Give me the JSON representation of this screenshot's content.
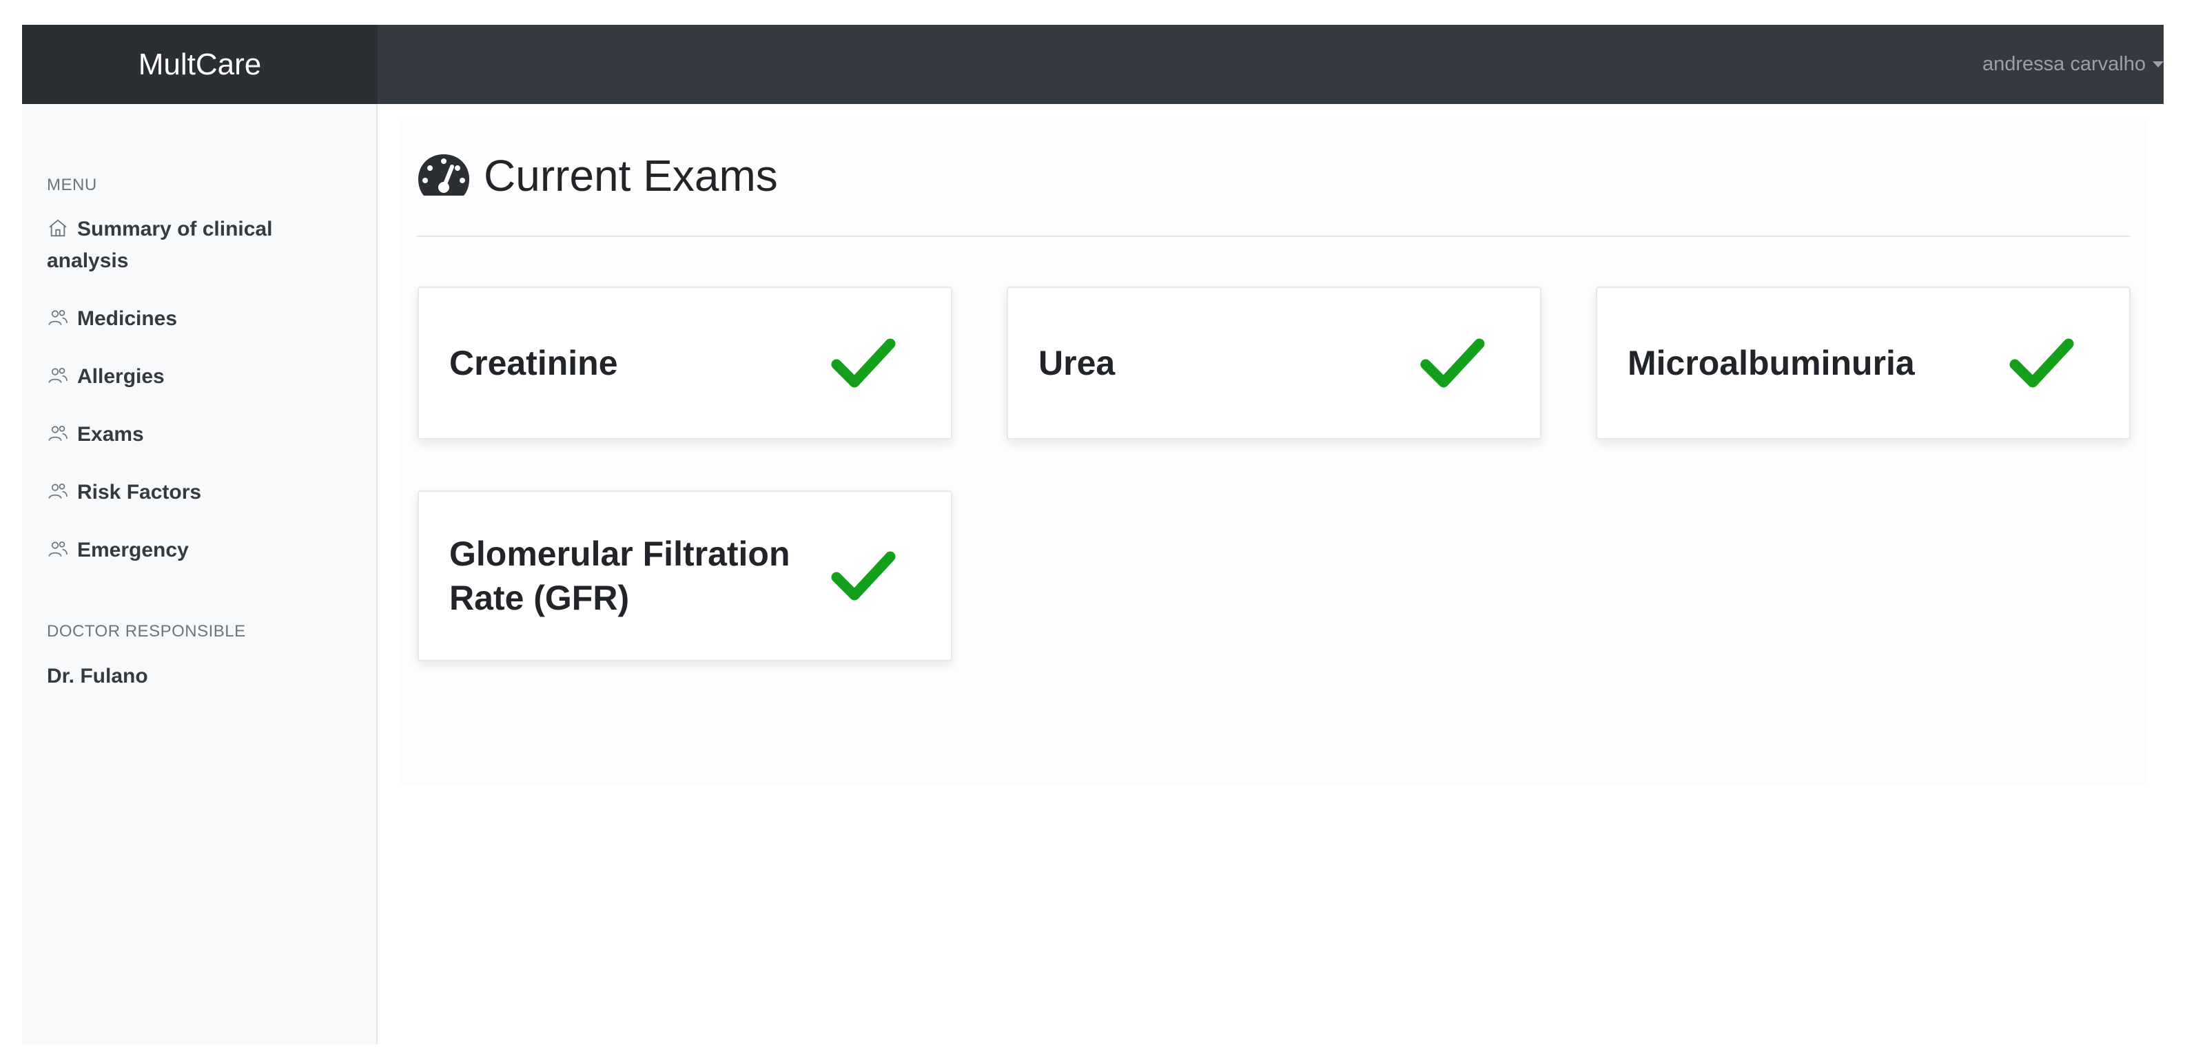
{
  "app": {
    "brand": "MultCare",
    "user": "andressa carvalho"
  },
  "sidebar": {
    "menu_heading": "MENU",
    "items": [
      {
        "label": "Summary of clinical analysis",
        "icon": "home-icon"
      },
      {
        "label": "Medicines",
        "icon": "users-icon"
      },
      {
        "label": "Allergies",
        "icon": "users-icon"
      },
      {
        "label": "Exams",
        "icon": "users-icon"
      },
      {
        "label": "Risk Factors",
        "icon": "users-icon"
      },
      {
        "label": "Emergency",
        "icon": "users-icon"
      }
    ],
    "doctor_heading": "DOCTOR RESPONSIBLE",
    "doctor_name": "Dr. Fulano"
  },
  "main": {
    "title": "Current Exams",
    "title_icon": "tachometer-icon",
    "exams": [
      {
        "name": "Creatinine",
        "status_icon": "check-icon"
      },
      {
        "name": "Urea",
        "status_icon": "check-icon"
      },
      {
        "name": "Microalbuminuria",
        "status_icon": "check-icon"
      },
      {
        "name": "Glomerular Filtration Rate (GFR)",
        "status_icon": "check-icon"
      }
    ]
  },
  "colors": {
    "navbar": "#353a41",
    "brand_bg": "#2b2f34",
    "sidebar_bg": "#f8f9fa",
    "check": "#14a01a"
  }
}
